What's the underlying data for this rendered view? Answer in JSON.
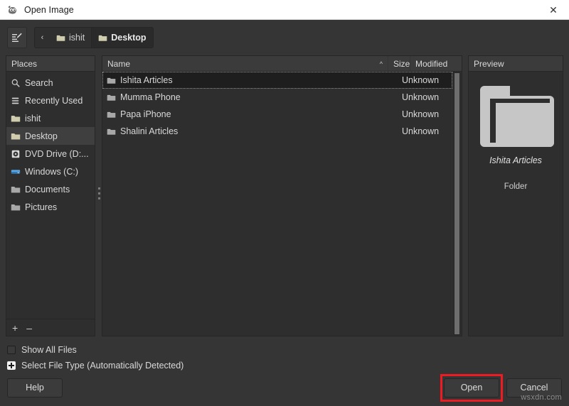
{
  "window": {
    "title": "Open Image",
    "app_icon": "gimp-wilber-icon",
    "close_label": "✕"
  },
  "toolbar": {
    "type_name_icon": "edit-filename-icon",
    "back_arrow": "‹",
    "breadcrumbs": [
      {
        "label": "ishit",
        "icon": "folder-icon",
        "active": false
      },
      {
        "label": "Desktop",
        "icon": "folder-icon",
        "active": true
      }
    ]
  },
  "places": {
    "header": "Places",
    "items": [
      {
        "label": "Search",
        "icon": "search-icon",
        "selected": false
      },
      {
        "label": "Recently Used",
        "icon": "recent-icon",
        "selected": false
      },
      {
        "label": "ishit",
        "icon": "folder-home-icon",
        "selected": false
      },
      {
        "label": "Desktop",
        "icon": "folder-desktop-icon",
        "selected": true
      },
      {
        "label": "DVD Drive (D:...",
        "icon": "optical-disc-icon",
        "selected": false
      },
      {
        "label": "Windows (C:)",
        "icon": "hard-drive-icon",
        "selected": false
      },
      {
        "label": "Documents",
        "icon": "folder-icon",
        "selected": false
      },
      {
        "label": "Pictures",
        "icon": "folder-icon",
        "selected": false
      }
    ],
    "add_label": "+",
    "remove_label": "–"
  },
  "filelist": {
    "columns": {
      "name": "Name",
      "size": "Size",
      "modified": "Modified"
    },
    "sort_indicator": "^",
    "rows": [
      {
        "name": "Ishita Articles",
        "size": "",
        "modified": "Unknown",
        "icon": "folder-icon",
        "selected": true
      },
      {
        "name": "Mumma Phone",
        "size": "",
        "modified": "Unknown",
        "icon": "folder-icon",
        "selected": false
      },
      {
        "name": "Papa iPhone",
        "size": "",
        "modified": "Unknown",
        "icon": "folder-icon",
        "selected": false
      },
      {
        "name": "Shalini Articles",
        "size": "",
        "modified": "Unknown",
        "icon": "folder-icon",
        "selected": false
      }
    ]
  },
  "preview": {
    "header": "Preview",
    "icon": "folder-icon",
    "name": "Ishita Articles",
    "kind": "Folder"
  },
  "options": {
    "show_all_files": {
      "label": "Show All Files",
      "checked": false
    },
    "select_file_type": {
      "label": "Select File Type (Automatically Detected)",
      "expanded": false
    }
  },
  "footer": {
    "help_label": "Help",
    "open_label": "Open",
    "cancel_label": "Cancel",
    "watermark": "wsxdn.com"
  },
  "colors": {
    "highlight": "#ee1b22",
    "window_bg": "#353535",
    "panel_bg": "#2e2e2e",
    "header_bg": "#3b3b3b",
    "selected_row_bg": "#1e1e1e",
    "folder_yellow": "#d8d6b6",
    "folder_grey": "#b6b6b6"
  }
}
